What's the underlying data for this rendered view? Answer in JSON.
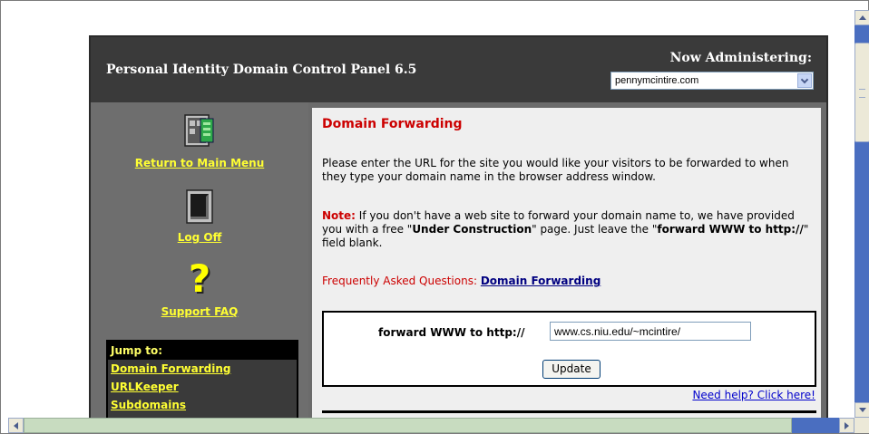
{
  "header": {
    "title": "Personal Identity Domain Control Panel 6.5",
    "admin_label": "Now Administering:",
    "domain_select": {
      "value": "pennymcintire.com"
    }
  },
  "sidebar": {
    "return_main": "Return to Main Menu",
    "log_off": "Log Off",
    "support_faq": "Support FAQ",
    "faq_icon": "?",
    "jump": {
      "title": "Jump to:",
      "items": [
        "Domain Forwarding",
        "URLKeeper",
        "Subdomains"
      ]
    }
  },
  "content": {
    "heading": "Domain Forwarding",
    "intro": "Please enter the URL for the site you would like your visitors to be forwarded to when they type your domain name in the browser address window.",
    "note_label": "Note:",
    "note_text_1": " If you don't have a web site to forward your domain name to, we have provided you with a free \"",
    "note_bold_1": "Under Construction",
    "note_text_2": "\" page. Just leave the \"",
    "note_bold_2": "forward WWW to http://",
    "note_text_3": "\" field blank.",
    "faq_prefix": "Frequently Asked Questions: ",
    "faq_link": "Domain Forwarding",
    "forward_label": "forward WWW to http://",
    "forward_value": "www.cs.niu.edu/~mcintire/",
    "update_button": "Update",
    "help_link": "Need help? Click here!"
  }
}
